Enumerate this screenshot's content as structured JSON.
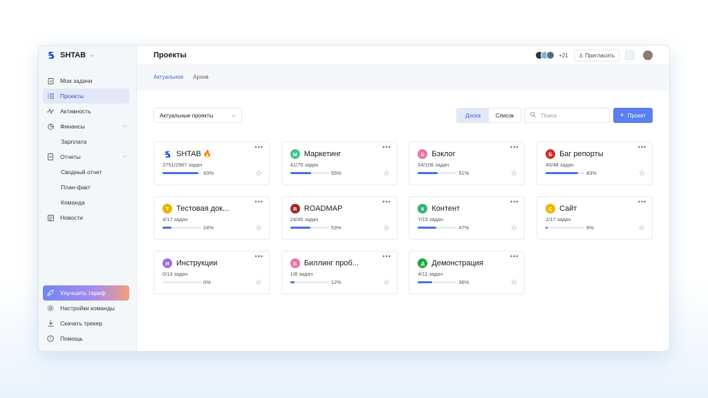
{
  "brand": {
    "name": "SHTAB"
  },
  "sidebar": {
    "items": [
      {
        "label": "Мои задачи",
        "icon": "clipboard-icon"
      },
      {
        "label": "Проекты",
        "icon": "list-icon",
        "active": true
      },
      {
        "label": "Активность",
        "icon": "activity-icon"
      },
      {
        "label": "Финансы",
        "icon": "pie-chart-icon",
        "expandable": true
      },
      {
        "label": "Зарплата",
        "sub": true
      },
      {
        "label": "Отчеты",
        "icon": "document-icon",
        "expandable": true
      },
      {
        "label": "Сводный отчет",
        "sub": true
      },
      {
        "label": "План-факт",
        "sub": true
      },
      {
        "label": "Команда",
        "sub": true
      },
      {
        "label": "Новости",
        "icon": "news-icon"
      }
    ],
    "bottom": [
      {
        "label": "Улучшить тариф",
        "icon": "rocket-icon"
      },
      {
        "label": "Настройки команды",
        "icon": "gear-icon"
      },
      {
        "label": "Скачать трекер",
        "icon": "download-icon"
      },
      {
        "label": "Помощь",
        "icon": "help-icon"
      }
    ]
  },
  "header": {
    "title": "Проекты",
    "members_more": "+21",
    "invite_label": "Пригласить"
  },
  "tabs": [
    {
      "label": "Актуальное",
      "active": true
    },
    {
      "label": "Архив"
    }
  ],
  "toolbar": {
    "filter_value": "Актуальные проекты",
    "view_board": "Доска",
    "view_list": "Список",
    "search_placeholder": "Поиск",
    "new_project": "Проект"
  },
  "colors": {
    "accent": "#5a7ff0",
    "progress": "#4c6fe0"
  },
  "projects": [
    {
      "name": "SHTAB",
      "letter": "",
      "color": "#1c4fd8",
      "tasks": "2751/2967 задач",
      "progress": 93,
      "pct": "93%",
      "fire": "🔥",
      "logo": true
    },
    {
      "name": "Маркетинг",
      "letter": "М",
      "color": "#3fc28a",
      "tasks": "41/75 задач",
      "progress": 55,
      "pct": "55%"
    },
    {
      "name": "Бэклог",
      "letter": "Б",
      "color": "#ee6fa8",
      "tasks": "54/106 задач",
      "progress": 51,
      "pct": "51%"
    },
    {
      "name": "Баг репорты",
      "letter": "Б",
      "color": "#d42a2a",
      "tasks": "40/48 задач",
      "progress": 83,
      "pct": "83%"
    },
    {
      "name": "Тестовая док...",
      "letter": "Т",
      "color": "#e6b400",
      "tasks": "4/17 задач",
      "progress": 24,
      "pct": "24%"
    },
    {
      "name": "ROADMAP",
      "letter": "R",
      "color": "#9a2b2b",
      "tasks": "24/45 задач",
      "progress": 53,
      "pct": "53%"
    },
    {
      "name": "Контент",
      "letter": "К",
      "color": "#2bb673",
      "tasks": "7/15 задач",
      "progress": 47,
      "pct": "47%"
    },
    {
      "name": "Сайт",
      "letter": "С",
      "color": "#f0b400",
      "tasks": "1/17 задач",
      "progress": 6,
      "pct": "6%"
    },
    {
      "name": "Инструкции",
      "letter": "И",
      "color": "#9b6ee0",
      "tasks": "0/13 задач",
      "progress": 0,
      "pct": "0%"
    },
    {
      "name": "Биллинг проб...",
      "letter": "Б",
      "color": "#ee6fa8",
      "tasks": "1/8 задач",
      "progress": 12,
      "pct": "12%"
    },
    {
      "name": "Демонстрация",
      "letter": "Д",
      "color": "#1aa83a",
      "tasks": "4/11 задач",
      "progress": 36,
      "pct": "36%"
    }
  ]
}
